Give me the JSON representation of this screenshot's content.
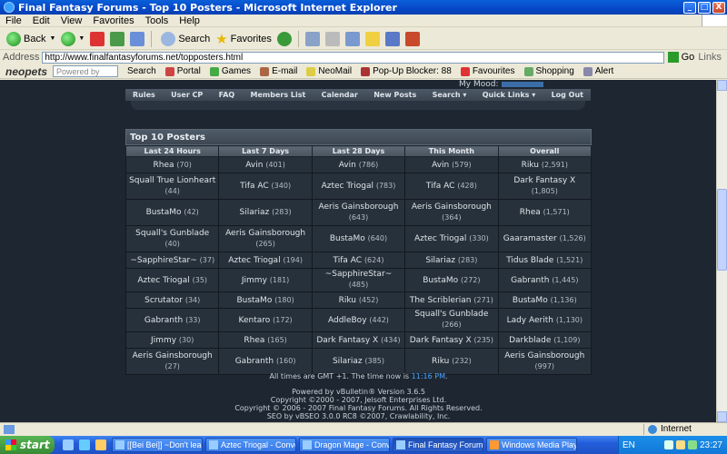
{
  "window": {
    "title": "Final Fantasy Forums - Top 10 Posters - Microsoft Internet Explorer",
    "controls": [
      "_",
      "□",
      "X"
    ]
  },
  "menu": [
    "File",
    "Edit",
    "View",
    "Favorites",
    "Tools",
    "Help"
  ],
  "toolbar": {
    "back": "Back",
    "search": "Search",
    "favorites": "Favorites"
  },
  "address": {
    "label": "Address",
    "url": "http://www.finalfantasyforums.net/topposters.html",
    "go": "Go",
    "links": "Links"
  },
  "neobar": {
    "logo": "neopets",
    "password_placeholder": "Powered by",
    "search": "Search",
    "items": [
      "Portal",
      "Games",
      "E-mail",
      "NeoMail",
      "Pop-Up Blocker: 88",
      "Favourites",
      "Shopping",
      "Alert"
    ]
  },
  "page": {
    "mood_label": "My Mood:",
    "nav": [
      "Rules",
      "User CP",
      "FAQ",
      "Members List",
      "Calendar",
      "New Posts",
      "Search ▾",
      "Quick Links ▾",
      "Log Out"
    ],
    "panel_title": "Top 10 Posters",
    "columns": [
      "Last 24 Hours",
      "Last 7 Days",
      "Last 28 Days",
      "This Month",
      "Overall"
    ],
    "rows": [
      [
        [
          "Rhea",
          "(70)"
        ],
        [
          "Avin",
          "(401)"
        ],
        [
          "Avin",
          "(786)"
        ],
        [
          "Avin",
          "(579)"
        ],
        [
          "Riku",
          "(2,591)"
        ]
      ],
      [
        [
          "Squall True Lionheart",
          "(44)"
        ],
        [
          "Tifa AC",
          "(340)"
        ],
        [
          "Aztec Triogal",
          "(783)"
        ],
        [
          "Tifa AC",
          "(428)"
        ],
        [
          "Dark Fantasy X",
          "(1,805)"
        ]
      ],
      [
        [
          "BustaMo",
          "(42)"
        ],
        [
          "Silariaz",
          "(283)"
        ],
        [
          "Aeris Gainsborough",
          "(643)"
        ],
        [
          "Aeris Gainsborough",
          "(364)"
        ],
        [
          "Rhea",
          "(1,571)"
        ]
      ],
      [
        [
          "Squall's Gunblade",
          "(40)"
        ],
        [
          "Aeris Gainsborough",
          "(265)"
        ],
        [
          "BustaMo",
          "(640)"
        ],
        [
          "Aztec Triogal",
          "(330)"
        ],
        [
          "Gaaramaster",
          "(1,526)"
        ]
      ],
      [
        [
          "~SapphireStar~",
          "(37)"
        ],
        [
          "Aztec Triogal",
          "(194)"
        ],
        [
          "Tifa AC",
          "(624)"
        ],
        [
          "Silariaz",
          "(283)"
        ],
        [
          "Tidus Blade",
          "(1,521)"
        ]
      ],
      [
        [
          "Aztec Triogal",
          "(35)"
        ],
        [
          "Jimmy",
          "(181)"
        ],
        [
          "~SapphireStar~",
          "(485)"
        ],
        [
          "BustaMo",
          "(272)"
        ],
        [
          "Gabranth",
          "(1,445)"
        ]
      ],
      [
        [
          "Scrutator",
          "(34)"
        ],
        [
          "BustaMo",
          "(180)"
        ],
        [
          "Riku",
          "(452)"
        ],
        [
          "The Scriblerian",
          "(271)"
        ],
        [
          "BustaMo",
          "(1,136)"
        ]
      ],
      [
        [
          "Gabranth",
          "(33)"
        ],
        [
          "Kentaro",
          "(172)"
        ],
        [
          "AddleBoy",
          "(442)"
        ],
        [
          "Squall's Gunblade",
          "(266)"
        ],
        [
          "Lady Aerith",
          "(1,130)"
        ]
      ],
      [
        [
          "Jimmy",
          "(30)"
        ],
        [
          "Rhea",
          "(165)"
        ],
        [
          "Dark Fantasy X",
          "(434)"
        ],
        [
          "Dark Fantasy X",
          "(235)"
        ],
        [
          "Darkblade",
          "(1,109)"
        ]
      ],
      [
        [
          "Aeris Gainsborough",
          "(27)"
        ],
        [
          "Gabranth",
          "(160)"
        ],
        [
          "Silariaz",
          "(385)"
        ],
        [
          "Riku",
          "(232)"
        ],
        [
          "Aeris Gainsborough",
          "(997)"
        ]
      ]
    ],
    "footer": {
      "times_prefix": "All times are GMT +1. The time now is ",
      "time_now": "11:16 PM",
      "times_suffix": ".",
      "powered": "Powered by vBulletin® Version 3.6.5",
      "copyright1": "Copyright ©2000 - 2007, Jelsoft Enterprises Ltd.",
      "copyright2": "Copyright © 2006 - 2007 Final Fantasy Forums. All Rights Reserved.",
      "seo": "SEO by vBSEO 3.0.0 RC8 ©2007, Crawlability, Inc."
    }
  },
  "status": {
    "zone": "Internet"
  },
  "taskbar": {
    "start": "start",
    "tasks": [
      "[[Bei Bei]] ~Don't lea...",
      "Aztec Triogal - Conve...",
      "Dragon Mage - Conv...",
      "Final Fantasy Forums...",
      "Windows Media Player"
    ],
    "lang": "EN",
    "clock": "23:27"
  },
  "colors": {
    "page_bg": "#1e2731",
    "cell_bg": "#27313b",
    "link_time": "#4ba3ff",
    "xp_blue": "#245edb"
  }
}
